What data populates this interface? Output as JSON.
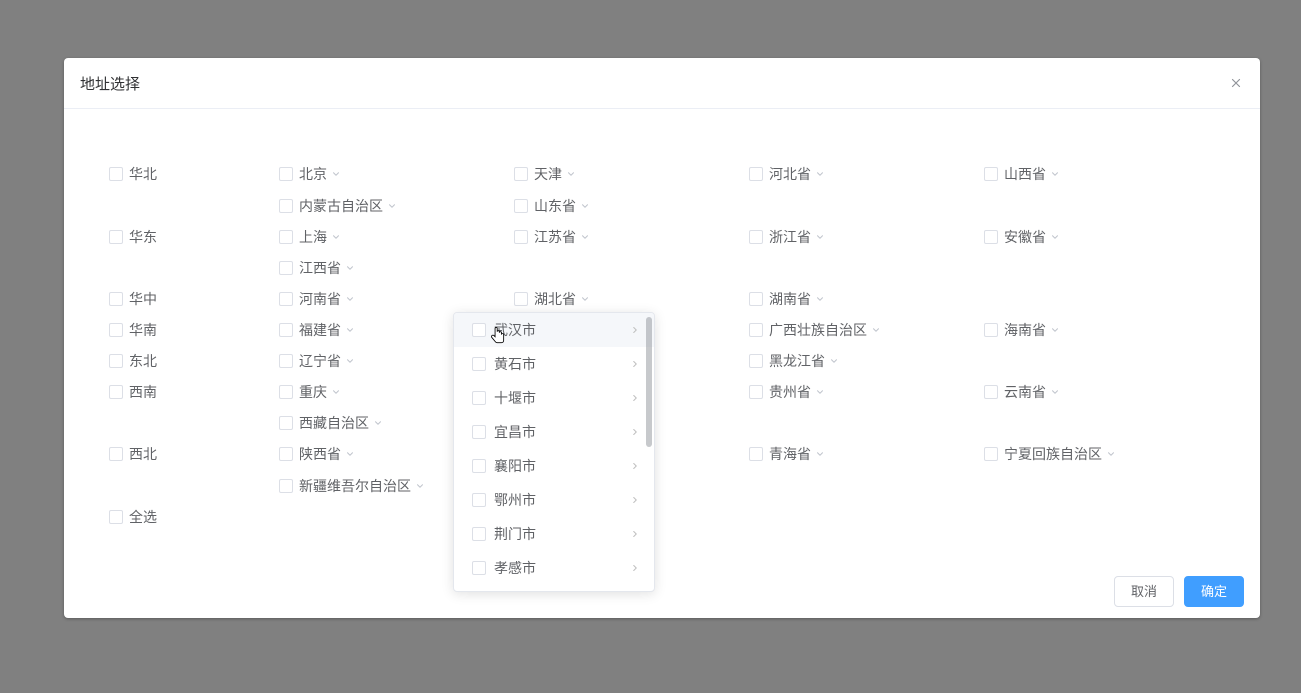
{
  "modal": {
    "title": "地址选择",
    "cancel": "取消",
    "confirm": "确定"
  },
  "regions": {
    "huabei": "华北",
    "huadong": "华东",
    "huazhong": "华中",
    "huanan": "华南",
    "dongbei": "东北",
    "xinan": "西南",
    "xibei": "西北",
    "quanxuan": "全选"
  },
  "provinces": {
    "beijing": "北京",
    "tianjin": "天津",
    "hebei": "河北省",
    "shanxi1": "山西省",
    "neimenggu": "内蒙古自治区",
    "shandong": "山东省",
    "shanghai": "上海",
    "jiangsu": "江苏省",
    "zhejiang": "浙江省",
    "anhui": "安徽省",
    "jiangxi": "江西省",
    "henan": "河南省",
    "hubei": "湖北省",
    "hunan": "湖南省",
    "fujian": "福建省",
    "guangxi": "广西壮族自治区",
    "hainan": "海南省",
    "liaoning": "辽宁省",
    "heilongjiang": "黑龙江省",
    "chongqing": "重庆",
    "guizhou": "贵州省",
    "yunnan": "云南省",
    "xizang": "西藏自治区",
    "shaanxi": "陕西省",
    "qinghai": "青海省",
    "ningxia": "宁夏回族自治区",
    "xinjiang": "新疆维吾尔自治区"
  },
  "cities": {
    "wuhan": "武汉市",
    "huangshi": "黄石市",
    "shiyan": "十堰市",
    "yichang": "宜昌市",
    "xiangyang": "襄阳市",
    "ezhou": "鄂州市",
    "jingmen": "荆门市",
    "xiaogan": "孝感市"
  }
}
